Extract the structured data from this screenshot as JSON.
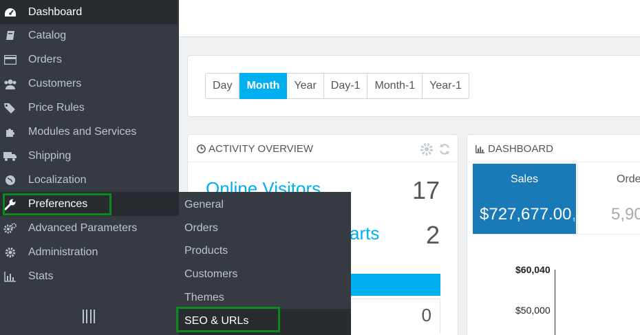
{
  "sidebar": {
    "items": [
      {
        "label": "Dashboard",
        "icon": "dashboard-icon"
      },
      {
        "label": "Catalog",
        "icon": "book-icon"
      },
      {
        "label": "Orders",
        "icon": "credit-card-icon"
      },
      {
        "label": "Customers",
        "icon": "users-icon"
      },
      {
        "label": "Price Rules",
        "icon": "tags-icon"
      },
      {
        "label": "Modules and Services",
        "icon": "puzzle-icon"
      },
      {
        "label": "Shipping",
        "icon": "truck-icon"
      },
      {
        "label": "Localization",
        "icon": "globe-icon"
      },
      {
        "label": "Preferences",
        "icon": "wrench-icon"
      },
      {
        "label": "Advanced Parameters",
        "icon": "cogs-icon"
      },
      {
        "label": "Administration",
        "icon": "cog-icon"
      },
      {
        "label": "Stats",
        "icon": "bar-chart-icon"
      }
    ]
  },
  "submenu": {
    "items": [
      "General",
      "Orders",
      "Products",
      "Customers",
      "Themes",
      "SEO & URLs"
    ]
  },
  "period": {
    "buttons": [
      "Day",
      "Month",
      "Year",
      "Day-1",
      "Month-1",
      "Year-1"
    ],
    "active": "Month"
  },
  "activity": {
    "title": "ACTIVITY OVERVIEW",
    "online_visitors_label": "Online Visitors",
    "online_visitors_value": "17",
    "carts_label": "arts",
    "carts_value": "2",
    "sub_value": "0"
  },
  "dashboard": {
    "title": "DASHBOARD",
    "sales_label": "Sales",
    "sales_value": "$727,677.00",
    "sales_suffix": "t",
    "orders_label": "Order",
    "orders_value": "5,90",
    "y_ticks": [
      "$60,040",
      "$50,000"
    ]
  },
  "colors": {
    "accent": "#00aff0",
    "sidebar": "#363a41",
    "highlight": "#0b8a1e",
    "sales_tile": "#1a7ab8"
  }
}
